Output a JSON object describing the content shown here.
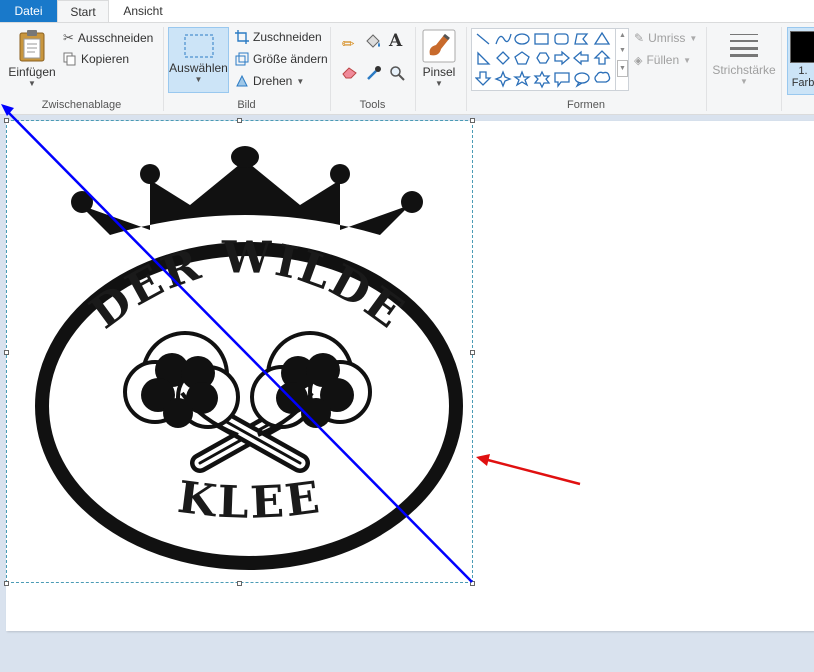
{
  "tabs": {
    "file": "Datei",
    "start": "Start",
    "view": "Ansicht"
  },
  "clipboard": {
    "paste": "Einfügen",
    "cut": "Ausschneiden",
    "copy": "Kopieren",
    "label": "Zwischenablage"
  },
  "image": {
    "select": "Auswählen",
    "crop": "Zuschneiden",
    "resize": "Größe ändern",
    "rotate": "Drehen",
    "label": "Bild"
  },
  "tools": {
    "label": "Tools"
  },
  "brushes": {
    "label": "Pinsel"
  },
  "shapes": {
    "outline": "Umriss",
    "fill": "Füllen",
    "label": "Formen"
  },
  "stroke": {
    "label": "Strichstärke"
  },
  "colors": {
    "color1_label": "1.",
    "color1_sub": "Farb",
    "color1": "#000000"
  },
  "logo": {
    "line1": "DER WILDE",
    "line2": "KLEE"
  },
  "accent": {
    "blue_line": "#0000ff",
    "red_arrow": "#e01010",
    "selected": "#cce4f7"
  }
}
